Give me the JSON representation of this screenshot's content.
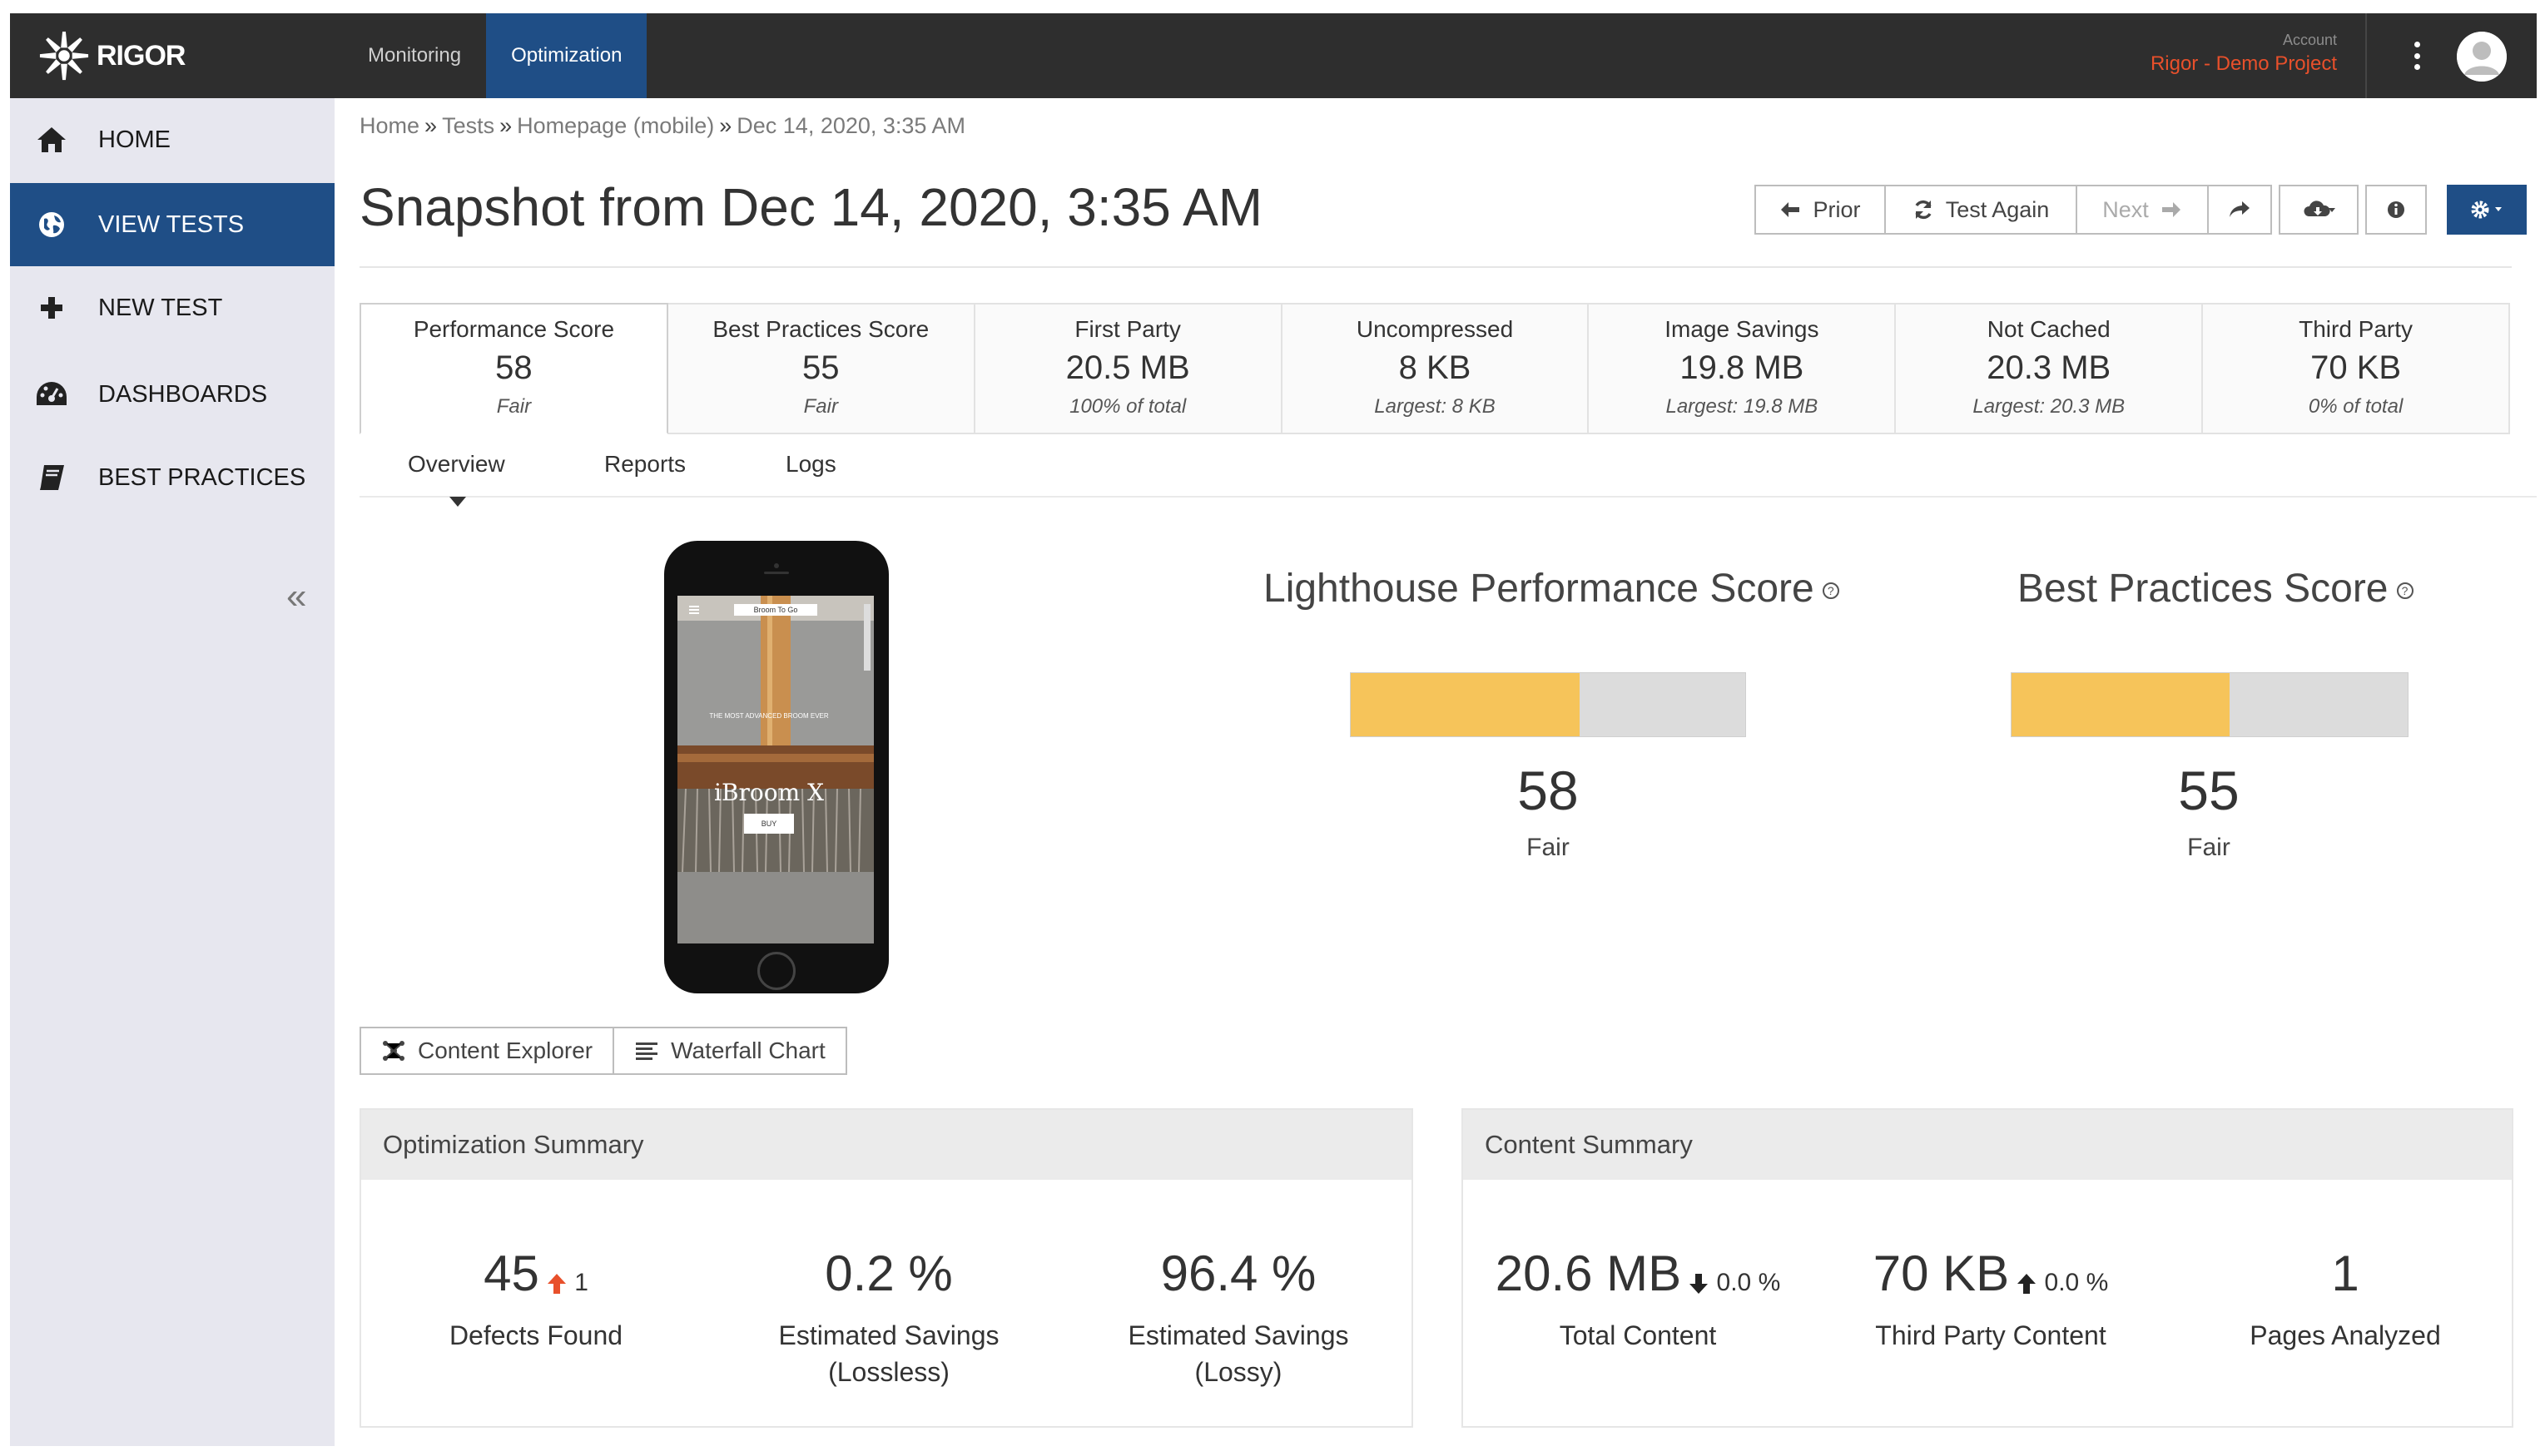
{
  "app": {
    "brand": "RIGOR"
  },
  "topnav": {
    "tabs": [
      {
        "label": "Monitoring",
        "active": false
      },
      {
        "label": "Optimization",
        "active": true
      }
    ],
    "account_label": "Account",
    "account_value": "Rigor - Demo Project"
  },
  "sidebar": {
    "items": [
      {
        "label": "HOME",
        "icon": "home-icon",
        "active": false
      },
      {
        "label": "VIEW TESTS",
        "icon": "globe-icon",
        "active": true
      },
      {
        "label": "NEW TEST",
        "icon": "plus-icon",
        "active": false
      },
      {
        "label": "DASHBOARDS",
        "icon": "dashboard-gauge-icon",
        "active": false
      },
      {
        "label": "BEST PRACTICES",
        "icon": "book-icon",
        "active": false
      }
    ],
    "collapse_glyph": "«"
  },
  "breadcrumb": {
    "items": [
      "Home",
      "Tests",
      "Homepage (mobile)",
      "Dec 14, 2020, 3:35 AM"
    ],
    "separator": "»"
  },
  "page": {
    "title": "Snapshot from Dec 14, 2020, 3:35 AM"
  },
  "toolbar": {
    "prior": "Prior",
    "test_again": "Test Again",
    "next": "Next"
  },
  "metrics": [
    {
      "label": "Performance Score",
      "value": "58",
      "sub": "Fair",
      "active": true
    },
    {
      "label": "Best Practices Score",
      "value": "55",
      "sub": "Fair",
      "active": false
    },
    {
      "label": "First Party",
      "value": "20.5 MB",
      "sub": "100% of total",
      "active": false
    },
    {
      "label": "Uncompressed",
      "value": "8 KB",
      "sub": "Largest: 8 KB",
      "active": false
    },
    {
      "label": "Image Savings",
      "value": "19.8 MB",
      "sub": "Largest: 19.8 MB",
      "active": false
    },
    {
      "label": "Not Cached",
      "value": "20.3 MB",
      "sub": "Largest: 20.3 MB",
      "active": false
    },
    {
      "label": "Third Party",
      "value": "70 KB",
      "sub": "0% of total",
      "active": false
    }
  ],
  "subtabs": [
    "Overview",
    "Reports",
    "Logs"
  ],
  "phone": {
    "menu_label": "Broom To Go",
    "headline": "THE MOST ADVANCED BROOM EVER",
    "product": "iBroom X",
    "cta": "BUY"
  },
  "view_buttons": {
    "content_explorer": "Content Explorer",
    "waterfall_chart": "Waterfall Chart"
  },
  "scores": {
    "lighthouse": {
      "title": "Lighthouse Performance Score",
      "value": "58",
      "fraction": 0.58,
      "rating": "Fair"
    },
    "best_practices": {
      "title": "Best Practices Score",
      "value": "55",
      "fraction": 0.55,
      "rating": "Fair"
    },
    "help_glyph": "?"
  },
  "optimization_summary": {
    "title": "Optimization Summary",
    "defects": {
      "value": "45",
      "delta": "1",
      "label": "Defects Found"
    },
    "lossless": {
      "value": "0.2 %",
      "label_line1": "Estimated Savings",
      "label_line2": "(Lossless)"
    },
    "lossy": {
      "value": "96.4 %",
      "label_line1": "Estimated Savings",
      "label_line2": "(Lossy)"
    }
  },
  "content_summary": {
    "title": "Content Summary",
    "total": {
      "value": "20.6 MB",
      "delta": "0.0 %",
      "label": "Total Content"
    },
    "third_party": {
      "value": "70 KB",
      "delta": "0.0 %",
      "label": "Third Party Content"
    },
    "pages": {
      "value": "1",
      "label": "Pages Analyzed"
    }
  },
  "colors": {
    "topbar": "#2e2e2e",
    "accent_blue": "#1f4e86",
    "account_orange": "#e8502b",
    "score_fill": "#f6c45a",
    "bar_track": "#dcdcdc",
    "sidebar_bg": "#e7e7ef"
  }
}
